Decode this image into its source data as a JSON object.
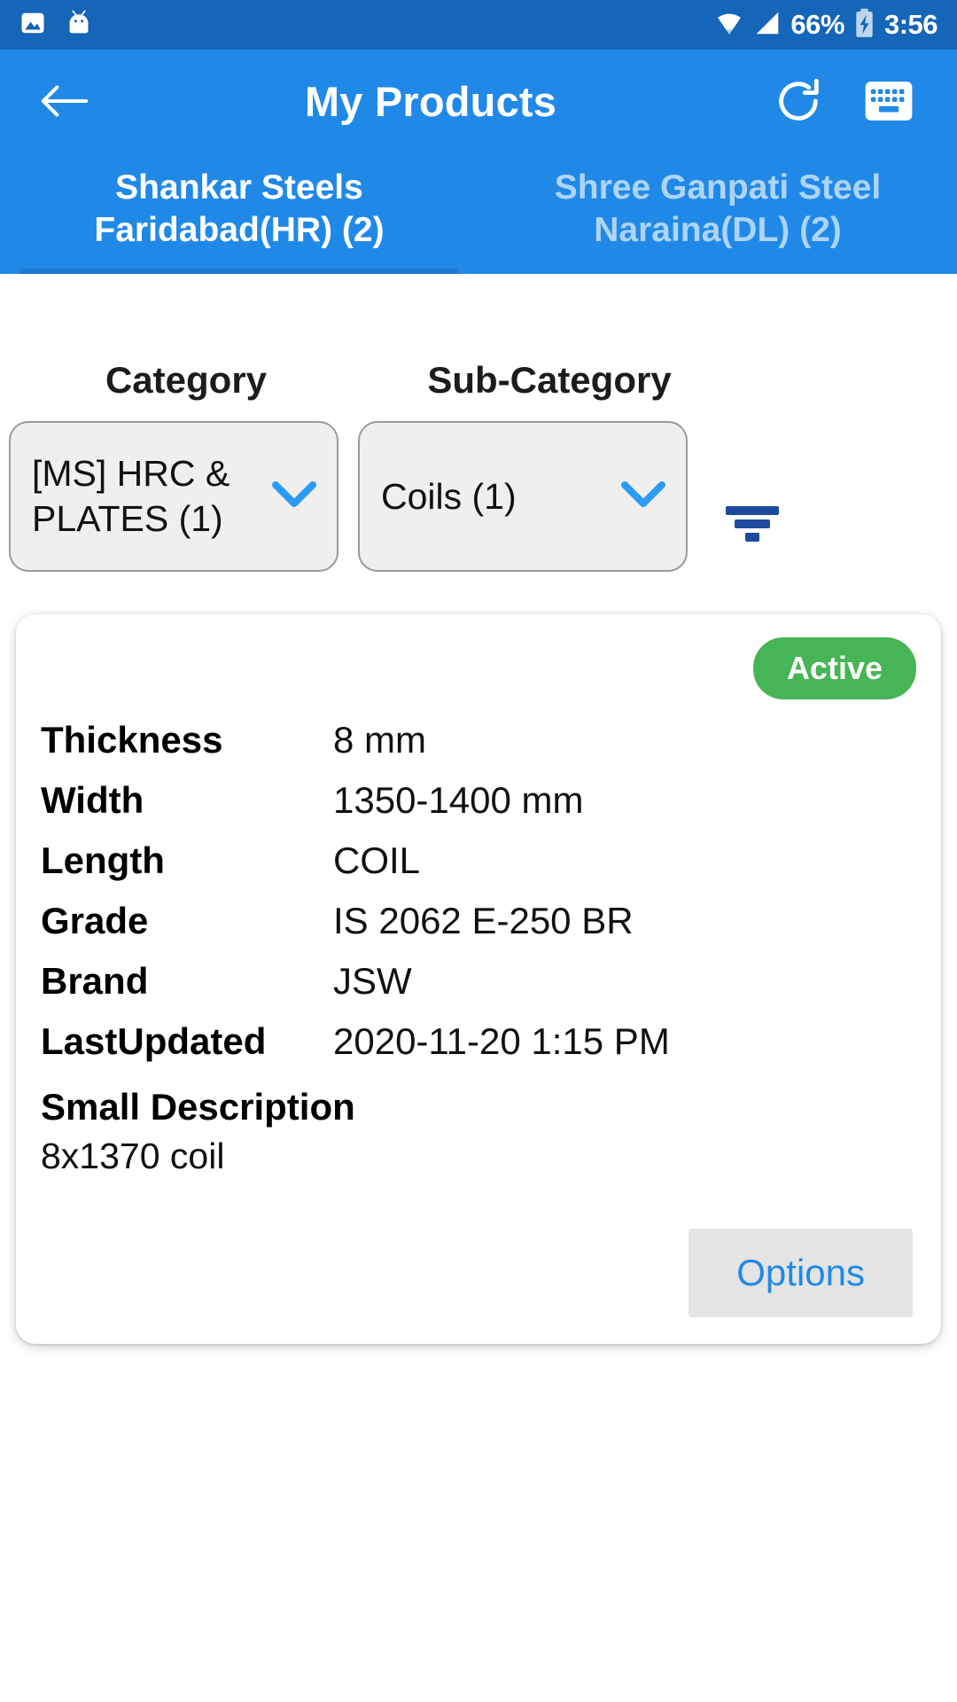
{
  "status_bar": {
    "icons_left": [
      "image-icon",
      "android-mascot-icon"
    ],
    "icons_right": [
      "wifi-icon",
      "signal-icon",
      "battery-charging-icon"
    ],
    "battery_percent": "66%",
    "clock": "3:56"
  },
  "appbar": {
    "back_icon": "back-arrow-icon",
    "title": "My Products",
    "refresh_icon": "refresh-icon",
    "keyboard_icon": "keyboard-icon"
  },
  "tabs": [
    {
      "line1": "Shankar Steels",
      "line2": "Faridabad(HR) (2)",
      "active": true
    },
    {
      "line1": "Shree Ganpati Steel",
      "line2": "Naraina(DL) (2)",
      "active": false
    }
  ],
  "filters": {
    "category_label": "Category",
    "subcategory_label": "Sub-Category",
    "category_value": "[MS]  HRC & PLATES (1)",
    "subcategory_value": "Coils (1)",
    "filter_icon": "filter-icon"
  },
  "product_card": {
    "status_badge": "Active",
    "specs": [
      {
        "key": "Thickness",
        "value": "8 mm"
      },
      {
        "key": "Width",
        "value": "1350-1400 mm"
      },
      {
        "key": "Length",
        "value": "COIL"
      },
      {
        "key": "Grade",
        "value": "IS 2062 E-250 BR"
      },
      {
        "key": "Brand",
        "value": "JSW"
      },
      {
        "key": "LastUpdated",
        "value": "2020-11-20  1:15 PM"
      }
    ],
    "description_title": "Small Description",
    "description_body": "8x1370 coil",
    "options_label": "Options"
  },
  "colors": {
    "status_bar": "#1565b8",
    "appbar": "#2089e8",
    "accent_blue": "#2089e8",
    "tab_inactive": "#aed4f5",
    "badge_green": "#45b555",
    "filter_icon": "#1d4a9c",
    "dropdown_bg": "#efefef"
  }
}
